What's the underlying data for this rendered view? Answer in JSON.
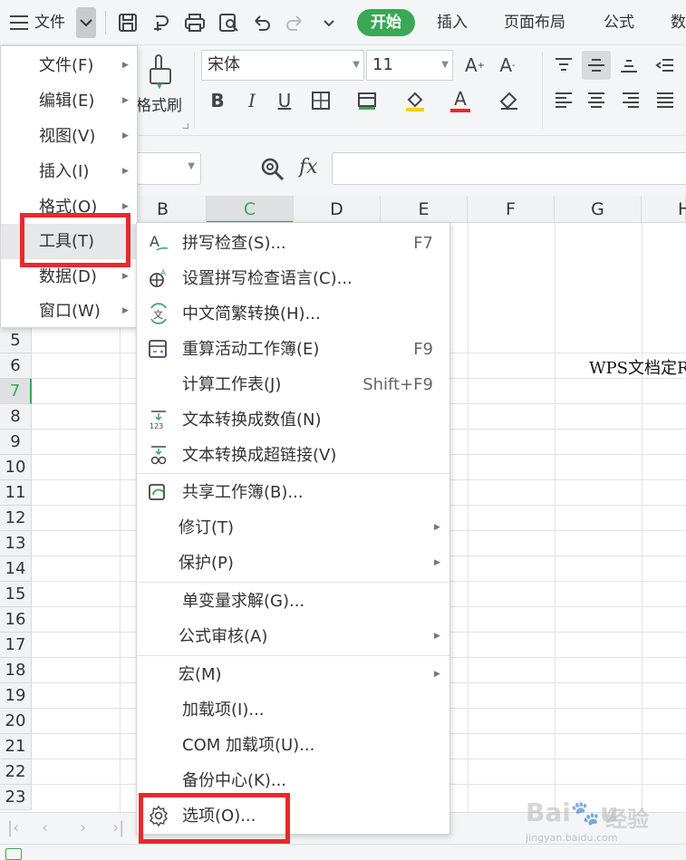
{
  "topbar": {
    "file_label": "文件",
    "start_tab": "开始",
    "tabs": [
      "插入",
      "页面布局",
      "公式",
      "数"
    ],
    "accent": "#3aa856"
  },
  "ribbon": {
    "format_painter": "格式刷",
    "font_name": "宋体",
    "font_size": "11",
    "bold": "B",
    "italic": "I",
    "underline": "U",
    "grow": "A",
    "shrink": "A",
    "font_color_glyph": "A"
  },
  "formula_bar": {
    "fx": "fx"
  },
  "columns": [
    "B",
    "C",
    "D",
    "E",
    "F",
    "G",
    "H"
  ],
  "rows": [
    "5",
    "6",
    "7",
    "8",
    "9",
    "10",
    "11",
    "12",
    "13",
    "14",
    "15",
    "16",
    "17",
    "18",
    "19",
    "20",
    "21",
    "22",
    "23"
  ],
  "cell_text": "WPS文档定R",
  "main_menu": [
    {
      "label": "文件(F)"
    },
    {
      "label": "编辑(E)"
    },
    {
      "label": "视图(V)"
    },
    {
      "label": "插入(I)"
    },
    {
      "label": "格式(O)"
    },
    {
      "label": "工具(T)"
    },
    {
      "label": "数据(D)"
    },
    {
      "label": "窗口(W)"
    }
  ],
  "tools_menu": [
    {
      "label": "拼写检查(S)...",
      "shortcut": "F7",
      "icon": "spell-check-icon"
    },
    {
      "label": "设置拼写检查语言(C)...",
      "shortcut": "",
      "icon": "language-globe-icon"
    },
    {
      "label": "中文简繁转换(H)...",
      "shortcut": "",
      "icon": "chinese-convert-icon"
    },
    {
      "label": "重算活动工作簿(E)",
      "shortcut": "F9",
      "icon": "recalc-workbook-icon"
    },
    {
      "label": "计算工作表(J)",
      "shortcut": "Shift+F9",
      "icon": ""
    },
    {
      "label": "文本转换成数值(N)",
      "shortcut": "",
      "icon": "text-to-number-icon"
    },
    {
      "label": "文本转换成超链接(V)",
      "shortcut": "",
      "icon": "text-to-link-icon"
    },
    {
      "label": "共享工作簿(B)...",
      "shortcut": "",
      "icon": "share-workbook-icon"
    },
    {
      "label": "修订(T)",
      "shortcut": "",
      "icon": ""
    },
    {
      "label": "保护(P)",
      "shortcut": "",
      "icon": ""
    },
    {
      "label": "单变量求解(G)...",
      "shortcut": "",
      "icon": ""
    },
    {
      "label": "公式审核(A)",
      "shortcut": "",
      "icon": ""
    },
    {
      "label": "宏(M)",
      "shortcut": "",
      "icon": ""
    },
    {
      "label": "加载项(I)...",
      "shortcut": "",
      "icon": ""
    },
    {
      "label": "COM 加载项(U)...",
      "shortcut": "",
      "icon": ""
    },
    {
      "label": "备份中心(K)...",
      "shortcut": "",
      "icon": ""
    },
    {
      "label": "选项(O)...",
      "shortcut": "",
      "icon": "gear-icon"
    }
  ],
  "highlight_color": "#e8292e",
  "watermark": "Baidu经验 jingyan.baidu.com"
}
